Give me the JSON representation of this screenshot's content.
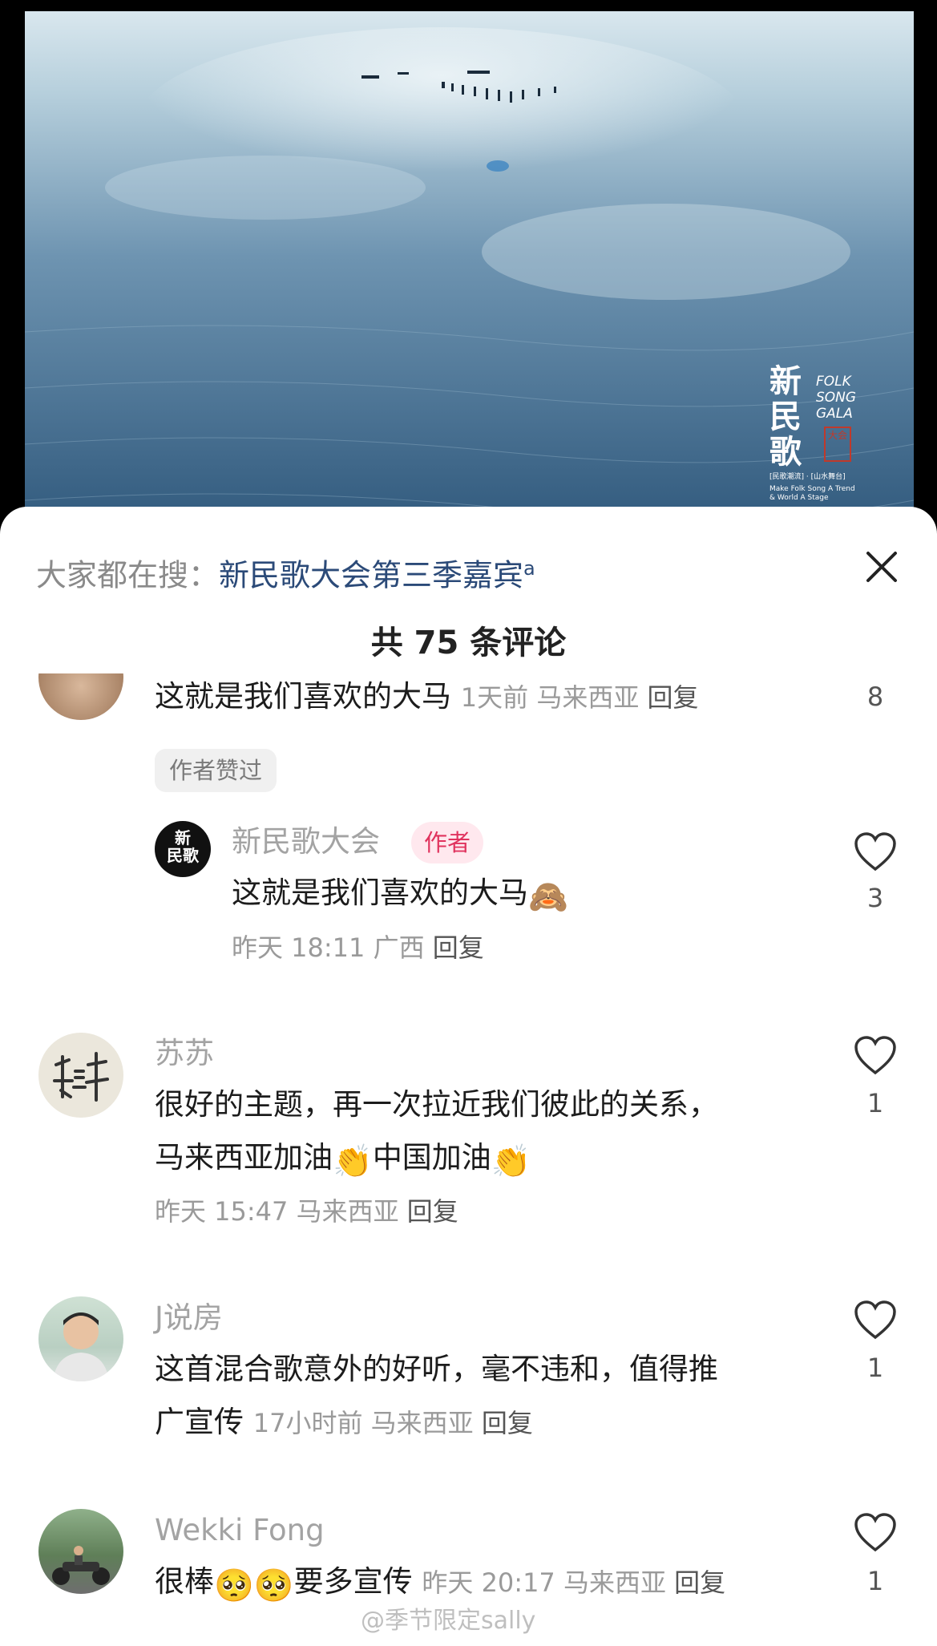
{
  "video": {
    "logo": {
      "title": "新民歌",
      "english": "FOLK SONG GALA",
      "seal": "大会",
      "tagline_cn": "[民歌潮流] · [山水舞台]",
      "tagline_en": "Make Folk Song A Trend & World A Stage"
    }
  },
  "search": {
    "prefix": "大家都在搜：",
    "term": "新民歌大会第三季嘉宾"
  },
  "comments_title": "共 75 条评论",
  "comments": [
    {
      "text": "这就是我们喜欢的大马",
      "time": "1天前",
      "location": "马来西亚",
      "reply_label": "回复",
      "likes": "8",
      "author_liked_badge": "作者赞过",
      "reply": {
        "name": "新民歌大会",
        "author_badge": "作者",
        "text": "这就是我们喜欢的大马",
        "emoji": "🙈",
        "time": "昨天 18:11",
        "location": "广西",
        "reply_label": "回复",
        "likes": "3"
      }
    },
    {
      "name": "苏苏",
      "line1": "很好的主题，再一次拉近我们彼此的关系，",
      "line2a": "马来西亚加油",
      "emoji": "👏",
      "line2b": "中国加油",
      "time": "昨天 15:47",
      "location": "马来西亚",
      "reply_label": "回复",
      "likes": "1"
    },
    {
      "name": "J说房",
      "line1": "这首混合歌意外的好听，毫不违和，值得推",
      "line2": "广宣传",
      "time": "17小时前",
      "location": "马来西亚",
      "reply_label": "回复",
      "likes": "1"
    },
    {
      "name": "Wekki Fong",
      "text_a": "很棒",
      "emoji": "🥺",
      "text_b": "要多宣传",
      "time": "昨天 20:17",
      "location": "马来西亚",
      "reply_label": "回复",
      "likes": "1"
    }
  ],
  "watermark": "@季节限定sally"
}
